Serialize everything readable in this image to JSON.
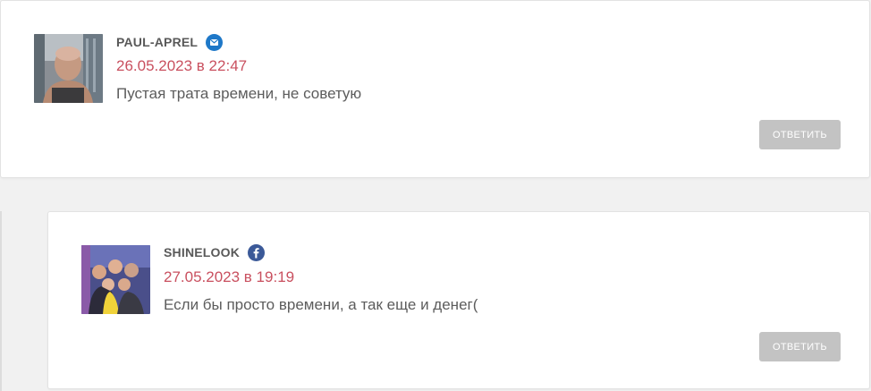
{
  "comments": [
    {
      "author": "PAUL-APREL",
      "network_icon": "mail-icon",
      "network_color": "#1e78c8",
      "date": "26.05.2023 в 22:47",
      "text": "Пустая трата времени, не советую",
      "reply_label": "ОТВЕТИТЬ"
    },
    {
      "author": "SHINELOOK",
      "network_icon": "facebook-icon",
      "network_color": "#3b5998",
      "date": "27.05.2023 в 19:19",
      "text": "Если бы просто времени, а так еще и денег(",
      "reply_label": "ОТВЕТИТЬ"
    }
  ],
  "colors": {
    "date": "#c9505f",
    "reply_button": "#c3c3c3",
    "background": "#f1f1f1"
  }
}
